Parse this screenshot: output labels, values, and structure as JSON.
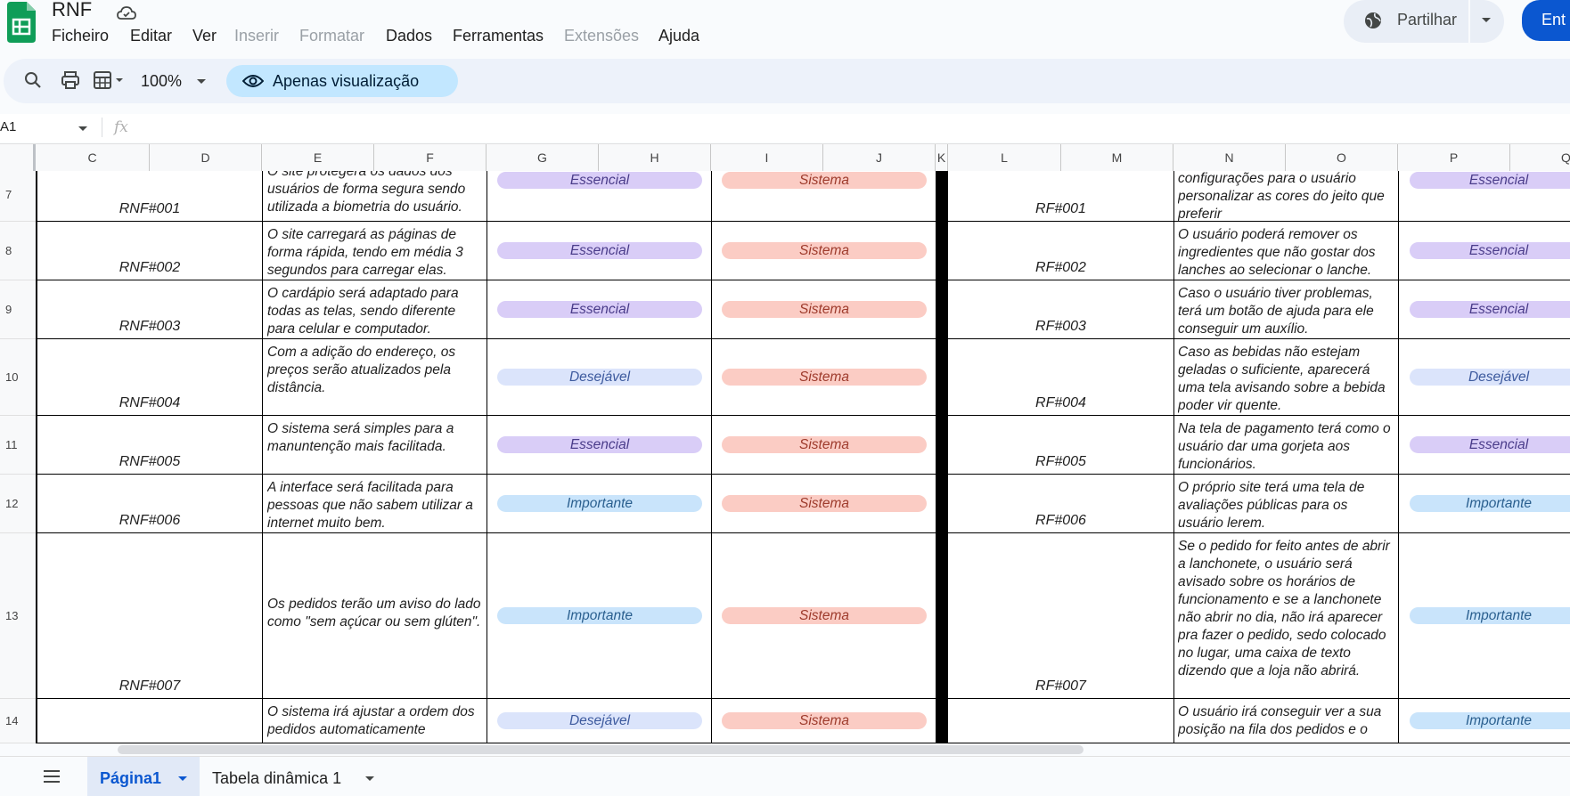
{
  "doc": {
    "title": "RNF"
  },
  "menu": [
    "Ficheiro",
    "Editar",
    "Ver",
    "Inserir",
    "Formatar",
    "Dados",
    "Ferramentas",
    "Extensões",
    "Ajuda"
  ],
  "menu_disabled": [
    false,
    false,
    false,
    true,
    true,
    false,
    false,
    true,
    false
  ],
  "share": {
    "label": "Partilhar"
  },
  "enter": {
    "label": "Ent"
  },
  "toolbar": {
    "zoom": "100%",
    "view_only": "Apenas visualização"
  },
  "formula": {
    "name_box": "A1",
    "fx": "fx"
  },
  "columns": [
    "C",
    "D",
    "E",
    "F",
    "G",
    "H",
    "I",
    "J",
    "K",
    "L",
    "M",
    "N",
    "O",
    "P",
    "Q"
  ],
  "rows": [
    {
      "num": "7",
      "rnf_id": "RNF#001",
      "rnf_desc": "O site protegerá os dados dos usuários de forma segura sendo utilizada a biometria do usuário.",
      "rnf_priority": "Essencial",
      "rnf_type": "Sistema",
      "rf_id": "RF#001",
      "rf_desc": "configurações para o usuário personalizar as cores do jeito que preferir",
      "rf_priority": "Essencial"
    },
    {
      "num": "8",
      "rnf_id": "RNF#002",
      "rnf_desc": "O site carregará as páginas de forma rápida, tendo em média 3 segundos para carregar elas.",
      "rnf_priority": "Essencial",
      "rnf_type": "Sistema",
      "rf_id": "RF#002",
      "rf_desc": "O usuário poderá remover os ingredientes que não gostar dos lanches ao selecionar o lanche.",
      "rf_priority": "Essencial"
    },
    {
      "num": "9",
      "rnf_id": "RNF#003",
      "rnf_desc": "O cardápio será adaptado para todas as telas, sendo diferente para celular e computador.",
      "rnf_priority": "Essencial",
      "rnf_type": "Sistema",
      "rf_id": "RF#003",
      "rf_desc": "Caso o usuário tiver problemas, terá um botão de ajuda para ele conseguir um auxílio.",
      "rf_priority": "Essencial"
    },
    {
      "num": "10",
      "rnf_id": "RNF#004",
      "rnf_desc": "Com a adição do endereço, os preços serão atualizados pela distância.",
      "rnf_priority": "Desejável",
      "rnf_type": "Sistema",
      "rf_id": "RF#004",
      "rf_desc": "Caso as bebidas não estejam geladas o suficiente, aparecerá uma tela avisando sobre a bebida poder vir quente.",
      "rf_priority": "Desejável"
    },
    {
      "num": "11",
      "rnf_id": "RNF#005",
      "rnf_desc": "O sistema será simples para a manuntenção mais facilitada.",
      "rnf_priority": "Essencial",
      "rnf_type": "Sistema",
      "rf_id": "RF#005",
      "rf_desc": "Na tela de pagamento terá como o usuário dar uma gorjeta aos funcionários.",
      "rf_priority": "Essencial"
    },
    {
      "num": "12",
      "rnf_id": "RNF#006",
      "rnf_desc": "A interface será facilitada para pessoas que não sabem utilizar a internet muito bem.",
      "rnf_priority": "Importante",
      "rnf_type": "Sistema",
      "rf_id": "RF#006",
      "rf_desc": "O próprio site terá uma tela de avaliações públicas para os usuário lerem.",
      "rf_priority": "Importante"
    },
    {
      "num": "13",
      "rnf_id": "RNF#007",
      "rnf_desc": "Os pedidos terão um aviso do lado como \"sem açúcar ou sem glúten\".",
      "rnf_priority": "Importante",
      "rnf_type": "Sistema",
      "rf_id": "RF#007",
      "rf_desc": "Se o pedido for feito antes de abrir a lanchonete, o usuário será avisado sobre os horários de funcionamento e se a lanchonete não abrir no dia, não irá aparecer pra fazer o pedido, sedo colocado no lugar, uma caixa de texto dizendo que a loja não abrirá.",
      "rf_priority": "Importante"
    },
    {
      "num": "14",
      "rnf_id": "",
      "rnf_desc": "O sistema irá ajustar a ordem dos pedidos automaticamente",
      "rnf_priority": "Desejável",
      "rnf_type": "Sistema",
      "rf_id": "",
      "rf_desc": "O usuário irá conseguir ver a sua posição na fila dos pedidos e o",
      "rf_priority": "Importante"
    }
  ],
  "sheets": {
    "active": "Página1",
    "second": "Tabela dinâmica 1"
  },
  "colors": {
    "accent": "#0b57d0",
    "sheets_green": "#0f9d58"
  }
}
